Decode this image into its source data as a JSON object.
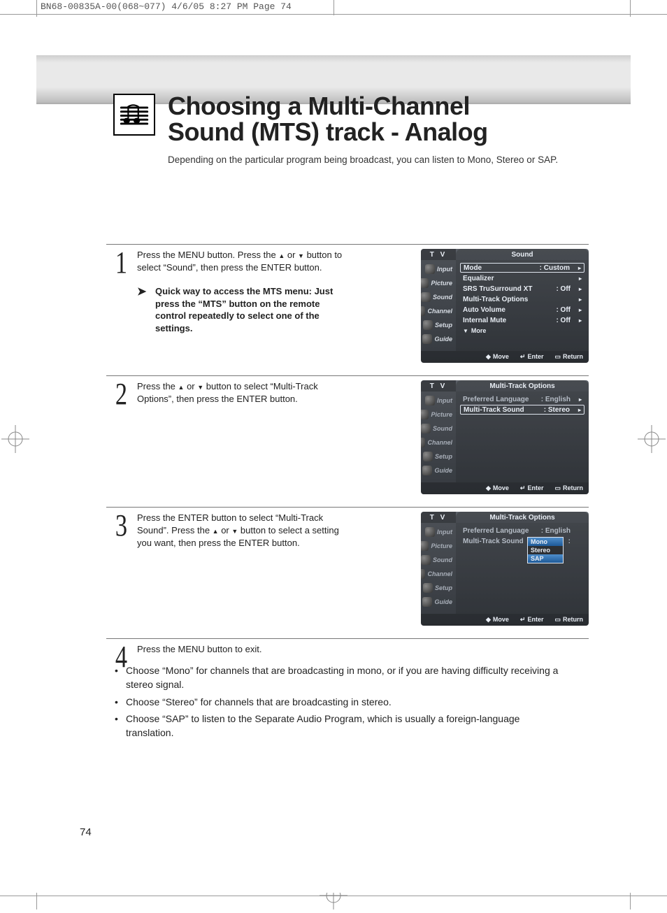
{
  "print_header": "BN68-00835A-00(068~077)  4/6/05  8:27 PM  Page 74",
  "title_line1": "Choosing a Multi-Channel",
  "title_line2": "Sound (MTS) track - Analog",
  "subtitle": "Depending on the particular program being broadcast, you can listen to Mono, Stereo or SAP.",
  "steps": {
    "s1": {
      "num": "1",
      "text_a": "Press the MENU button. Press the ",
      "text_b": " or ",
      "text_c": " button to select “Sound”, then press the ENTER button.",
      "tip": "Quick way to access the MTS menu: Just press the “MTS” button on the remote control repeatedly to select one of the settings."
    },
    "s2": {
      "num": "2",
      "text_a": "Press the ",
      "text_b": " or ",
      "text_c": " button to select “Multi-Track Options”, then press the ENTER button."
    },
    "s3": {
      "num": "3",
      "text_a": "Press the ENTER button to select “Multi-Track Sound”. Press the ",
      "text_b": " or ",
      "text_c": " button to select a setting you want, then press the ENTER button."
    },
    "s4": {
      "num": "4",
      "text": "Press the MENU button to exit."
    }
  },
  "bullets": {
    "b1": "Choose “Mono” for channels that are broadcasting in mono, or if you are having difficulty receiving a stereo signal.",
    "b2": "Choose “Stereo” for channels that are broadcasting in stereo.",
    "b3": "Choose “SAP” to listen to the Separate Audio Program, which is usually a foreign-language translation."
  },
  "page_number": "74",
  "osd_common": {
    "tv": "T V",
    "sidebar": {
      "input": "Input",
      "picture": "Picture",
      "sound": "Sound",
      "channel": "Channel",
      "setup": "Setup",
      "guide": "Guide"
    },
    "footer": {
      "move": "Move",
      "enter": "Enter",
      "return": "Return"
    }
  },
  "osd1": {
    "title": "Sound",
    "rows": {
      "mode": {
        "label": "Mode",
        "value": ": Custom"
      },
      "eq": {
        "label": "Equalizer",
        "value": ""
      },
      "srs": {
        "label": "SRS TruSurround XT",
        "value": ": Off"
      },
      "mto": {
        "label": "Multi-Track Options",
        "value": ""
      },
      "autovol": {
        "label": "Auto Volume",
        "value": ": Off"
      },
      "intmute": {
        "label": "Internal Mute",
        "value": ": Off"
      }
    },
    "more": "More"
  },
  "osd2": {
    "title": "Multi-Track Options",
    "rows": {
      "preflang": {
        "label": "Preferred Language",
        "value": ": English"
      },
      "mts": {
        "label": "Multi-Track Sound",
        "value": ": Stereo"
      }
    }
  },
  "osd3": {
    "title": "Multi-Track Options",
    "rows": {
      "preflang": {
        "label": "Preferred Language",
        "value": ": English"
      },
      "mts": {
        "label": "Multi-Track Sound",
        "value": ":"
      }
    },
    "dropdown": {
      "mono": "Mono",
      "stereo": "Stereo",
      "sap": "SAP"
    }
  }
}
